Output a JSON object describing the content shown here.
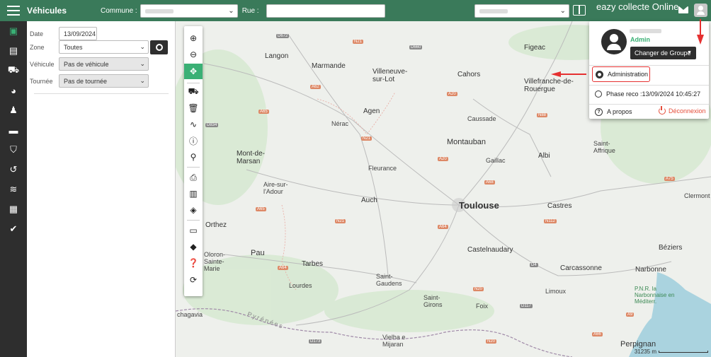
{
  "header": {
    "title": "Véhicules",
    "commune_label": "Commune :",
    "rue_label": "Rue :",
    "brand": "eazy collecte Online"
  },
  "filters": {
    "date_label": "Date",
    "date_value": "13/09/2024",
    "zone_label": "Zone",
    "zone_value": "Toutes",
    "vehicule_label": "Véhicule",
    "vehicule_value": "Pas de véhicule",
    "tournee_label": "Tournée",
    "tournee_value": "Pas de tournée"
  },
  "user_menu": {
    "role": "Admin",
    "change_group": "Changer de Groupe",
    "administration": "Administration",
    "phase": "Phase reco :13/09/2024 10:45:27",
    "about": "A propos",
    "logout": "Déconnexion"
  },
  "map": {
    "places": {
      "langon": "Langon",
      "marmande": "Marmande",
      "villeneuve": "Villeneuve-\nsur-Lot",
      "figeac": "Figeac",
      "cahors": "Cahors",
      "villefranche": "Villefranche-de-\nRouergue",
      "agen": "Agen",
      "nerac": "Nérac",
      "caussade": "Caussade",
      "montauban": "Montauban",
      "gaillac": "Gaillac",
      "albi": "Albi",
      "saint_affrique": "Saint-\nAffrique",
      "mont_de_marsan": "Mont-de-\nMarsan",
      "fleurance": "Fleurance",
      "aire": "Aire-sur-\nl'Adour",
      "auch": "Auch",
      "toulouse": "Toulouse",
      "castres": "Castres",
      "clermont": "Clermont",
      "orthez": "Orthez",
      "oloron": "Oloron-\nSainte-\nMarie",
      "pau": "Pau",
      "tarbes": "Tarbes",
      "castelnaudary": "Castelnaudary",
      "beziers": "Béziers",
      "lourdes": "Lourdes",
      "saint_gaudens": "Saint-\nGaudens",
      "carcassonne": "Carcassonne",
      "narbonne": "Narbonne",
      "limoux": "Limoux",
      "saint_girons": "Saint-\nGirons",
      "foix": "Foix",
      "pnr": "P.N.R. la\nNarbonnaise en\nMéditerr.",
      "chagavia": "chagavia",
      "pyrenees": "Pyrénées",
      "vielha": "Vielha e\nMijaran",
      "perpignan": "Perpignan"
    },
    "roads": [
      "D672",
      "N21",
      "D660",
      "A62",
      "A65",
      "A20",
      "N88",
      "D834",
      "N21",
      "A20",
      "A68",
      "A75",
      "A65",
      "N21",
      "A64",
      "N112",
      "A64",
      "D4",
      "N20",
      "D117",
      "A9",
      "D173",
      "N20",
      "A66"
    ],
    "scale": "31235 m"
  }
}
